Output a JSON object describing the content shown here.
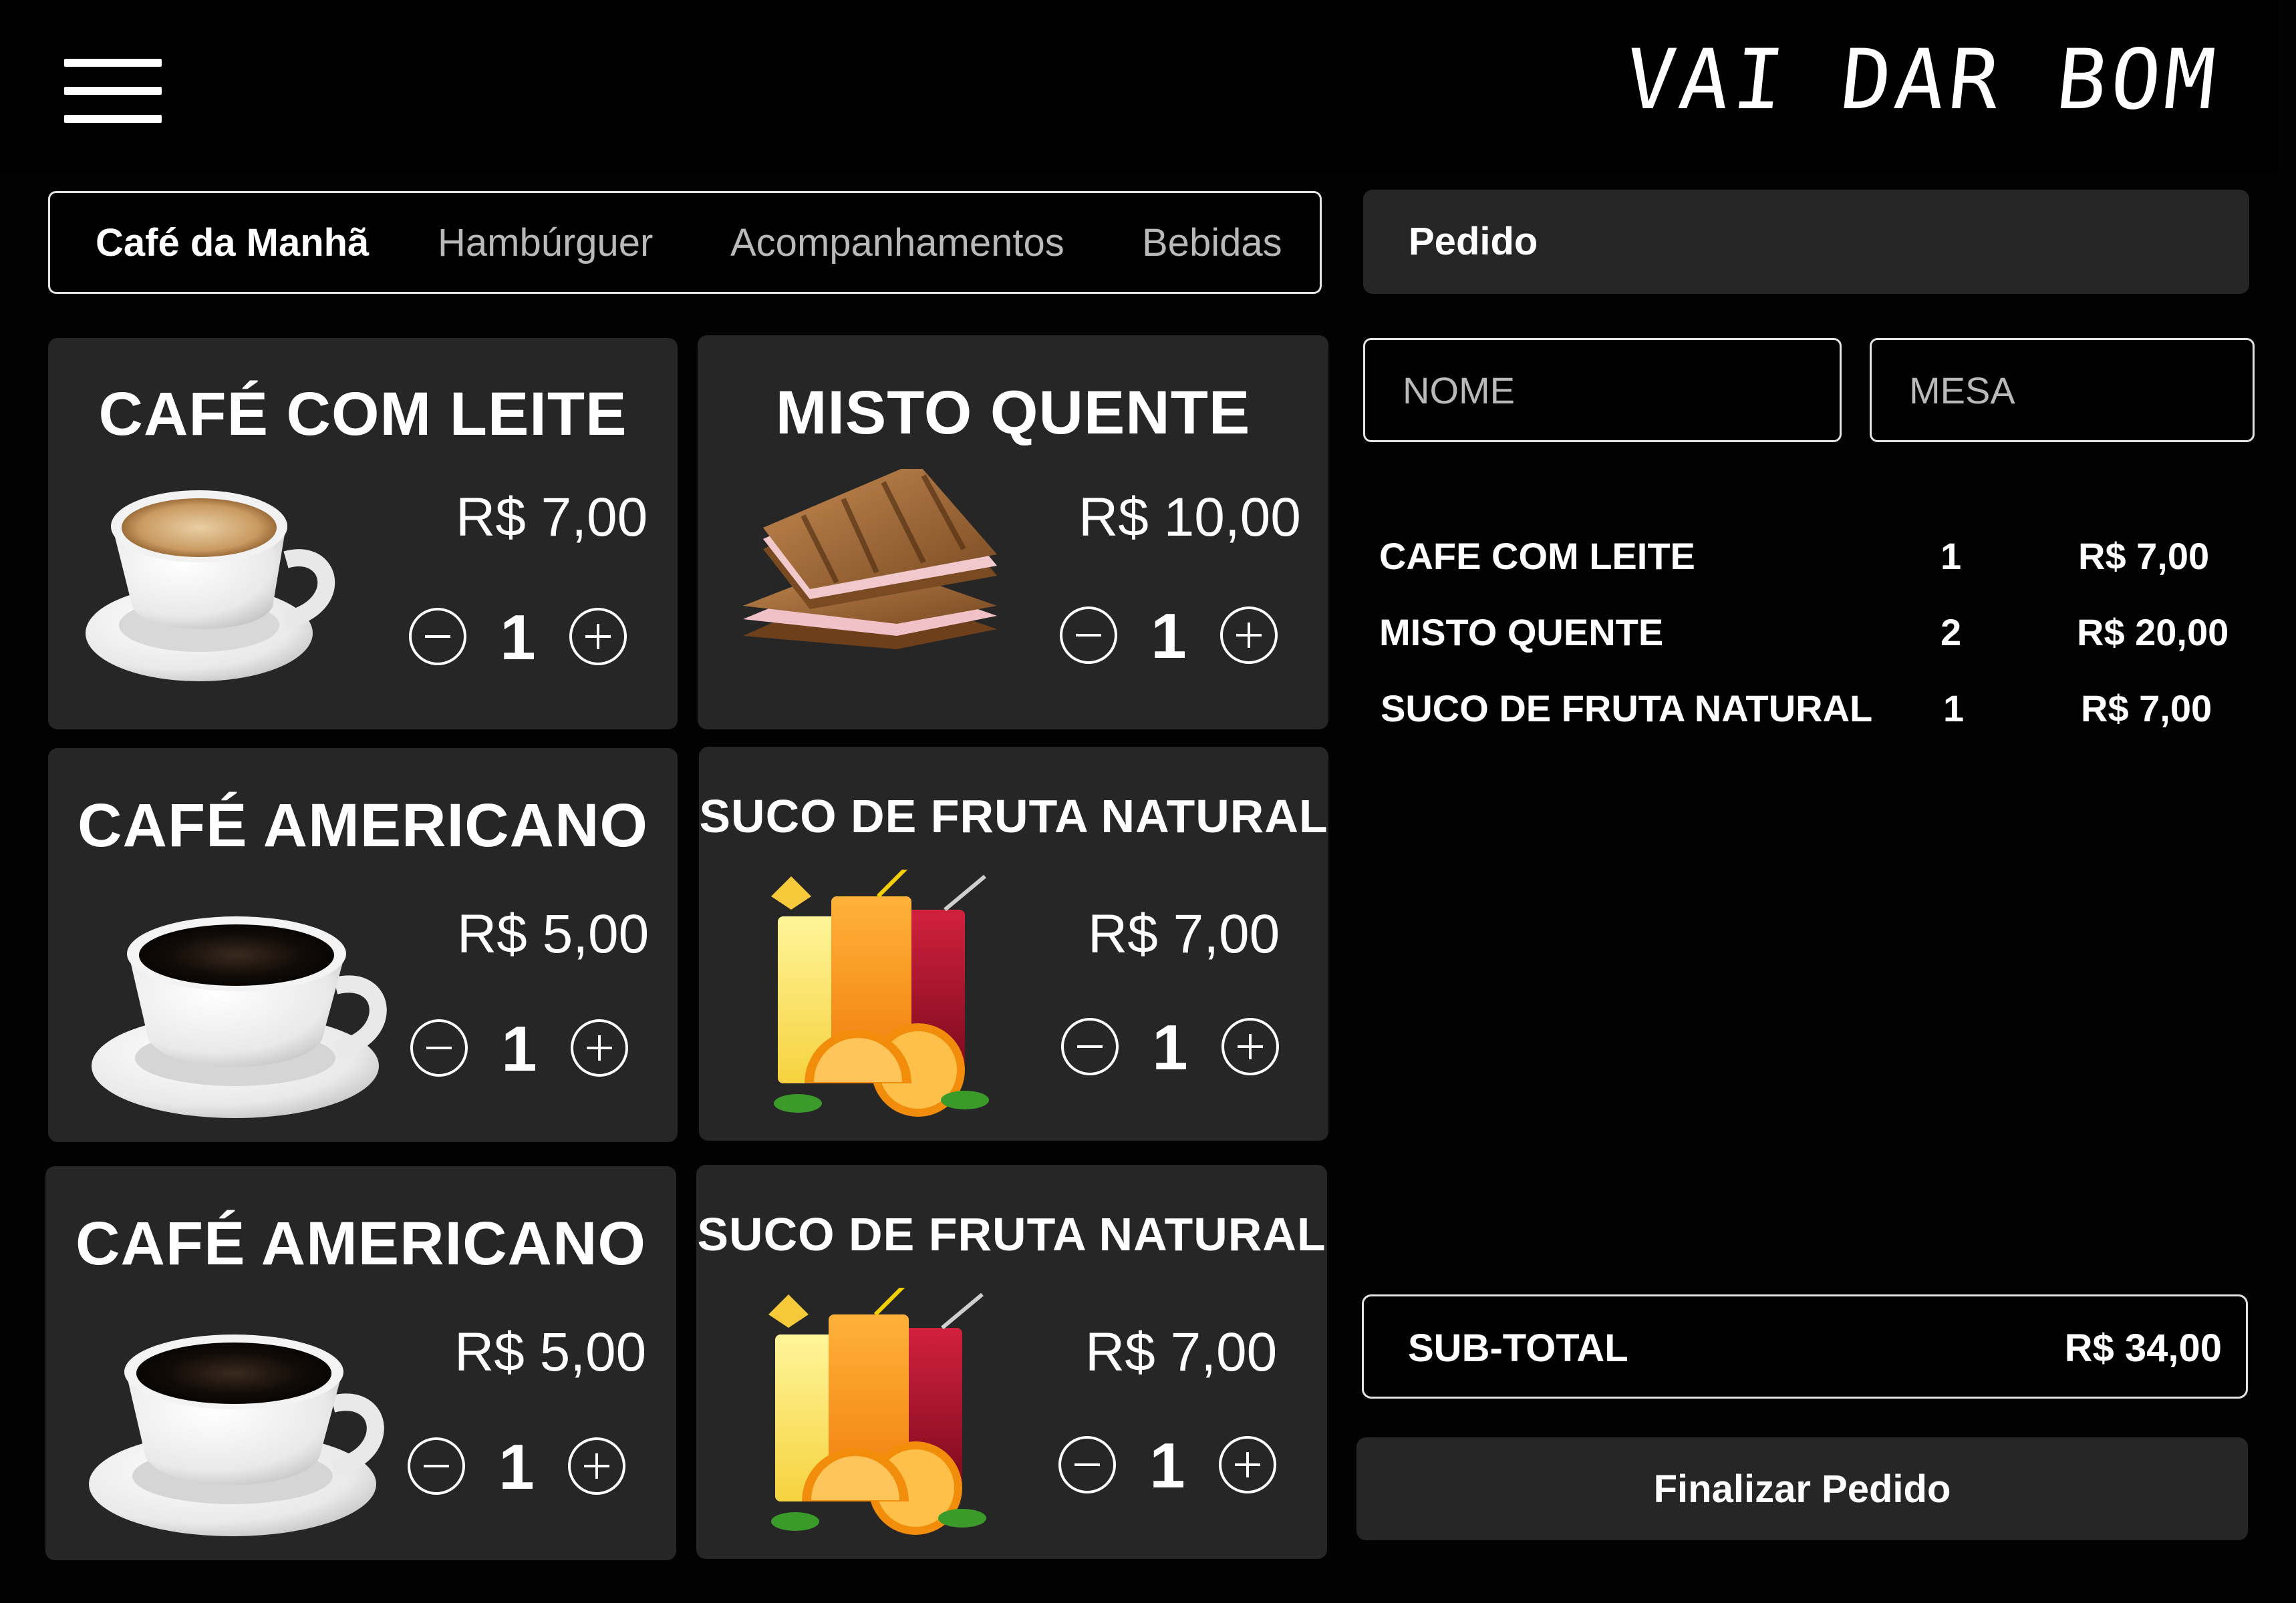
{
  "header": {
    "brand": "VAI DAR BOM",
    "menu_icon": "hamburger-menu-icon"
  },
  "tabs": [
    {
      "label": "Café da Manhã",
      "active": true
    },
    {
      "label": "Hambúrguer",
      "active": false
    },
    {
      "label": "Acompanhamentos",
      "active": false
    },
    {
      "label": "Bebidas",
      "active": false
    }
  ],
  "products": [
    {
      "name": "CAFÉ COM LEITE",
      "price": "R$ 7,00",
      "qty": "1",
      "image": "coffee-with-milk-cup"
    },
    {
      "name": "MISTO QUENTE",
      "price": "R$ 10,00",
      "qty": "1",
      "image": "grilled-ham-cheese-sandwich"
    },
    {
      "name": "CAFÉ AMERICANO",
      "price": "R$ 5,00",
      "qty": "1",
      "image": "black-coffee-cup"
    },
    {
      "name": "SUCO DE FRUTA NATURAL",
      "price": "R$ 7,00",
      "qty": "1",
      "image": "fruit-juice-glasses"
    },
    {
      "name": "CAFÉ AMERICANO",
      "price": "R$ 5,00",
      "qty": "1",
      "image": "black-coffee-cup"
    },
    {
      "name": "SUCO DE FRUTA NATURAL",
      "price": "R$ 7,00",
      "qty": "1",
      "image": "fruit-juice-glasses"
    }
  ],
  "order": {
    "title": "Pedido",
    "name_placeholder": "NOME",
    "table_placeholder": "MESA",
    "items": [
      {
        "name": "CAFE COM LEITE",
        "qty": "1",
        "total": "R$ 7,00"
      },
      {
        "name": "MISTO QUENTE",
        "qty": "2",
        "total": "R$ 20,00"
      },
      {
        "name": "SUCO DE FRUTA NATURAL",
        "qty": "1",
        "total": "R$ 7,00"
      }
    ],
    "subtotal_label": "SUB-TOTAL",
    "subtotal_value": "R$ 34,00",
    "finalize_label": "Finalizar Pedido"
  },
  "colors": {
    "background": "#020202",
    "card": "#262626",
    "border": "#e4e4e4",
    "muted_text": "#b9b9b9"
  }
}
